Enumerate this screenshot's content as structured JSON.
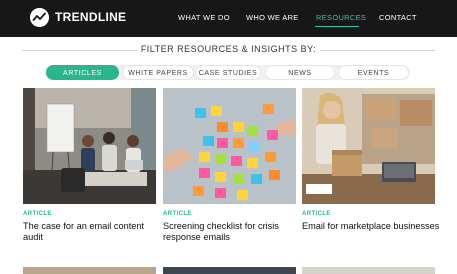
{
  "brand": {
    "name": "TRENDLINE"
  },
  "nav": [
    {
      "label": "WHAT WE DO",
      "active": false
    },
    {
      "label": "WHO WE ARE",
      "active": false
    },
    {
      "label": "RESOURCES",
      "active": true
    },
    {
      "label": "CONTACT",
      "active": false
    }
  ],
  "filter": {
    "title": "FILTER RESOURCES & INSIGHTS BY:",
    "pills": [
      {
        "label": "ARTICLES",
        "active": true
      },
      {
        "label": "WHITE PAPERS",
        "active": false
      },
      {
        "label": "CASE STUDIES",
        "active": false
      },
      {
        "label": "NEWS",
        "active": false
      },
      {
        "label": "EVENTS",
        "active": false
      }
    ]
  },
  "cards": [
    {
      "tag": "ARTICLE",
      "title": "The case for an email content audit",
      "image": "office-meeting-photo"
    },
    {
      "tag": "ARTICLE",
      "title": "Screening checklist for crisis response emails",
      "image": "sticky-notes-wall-photo"
    },
    {
      "tag": "ARTICLE",
      "title": "Email for marketplace businesses",
      "image": "woman-packing-box-photo"
    }
  ],
  "colors": {
    "header_bg": "#171717",
    "accent": "#28b58f",
    "nav_active": "#35c2a5"
  }
}
